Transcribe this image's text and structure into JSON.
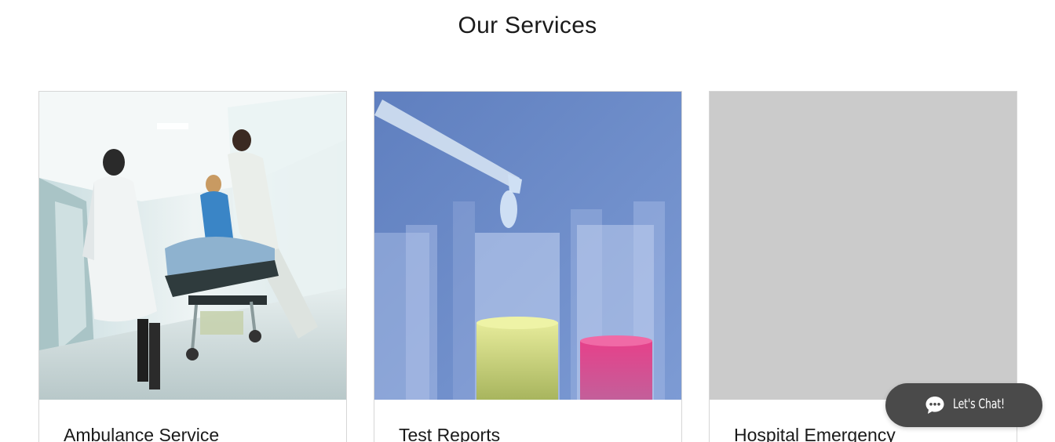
{
  "section": {
    "title": "Our Services"
  },
  "services": [
    {
      "title": "Ambulance Service",
      "image": "hospital-staff-moving-patient-photo"
    },
    {
      "title": "Test Reports",
      "image": "lab-test-tubes-pipette-photo"
    },
    {
      "title": "Hospital Emergency",
      "image": "gray-placeholder"
    }
  ],
  "chat": {
    "label": "Let's Chat!",
    "icon": "chat-bubble-icon"
  },
  "colors": {
    "background": "#ffffff",
    "text": "#1a1a1a",
    "card_border": "#d6d6d6",
    "placeholder": "#cbcbcb",
    "chat_bg": "#4a4a4a",
    "chat_text": "#ffffff"
  }
}
